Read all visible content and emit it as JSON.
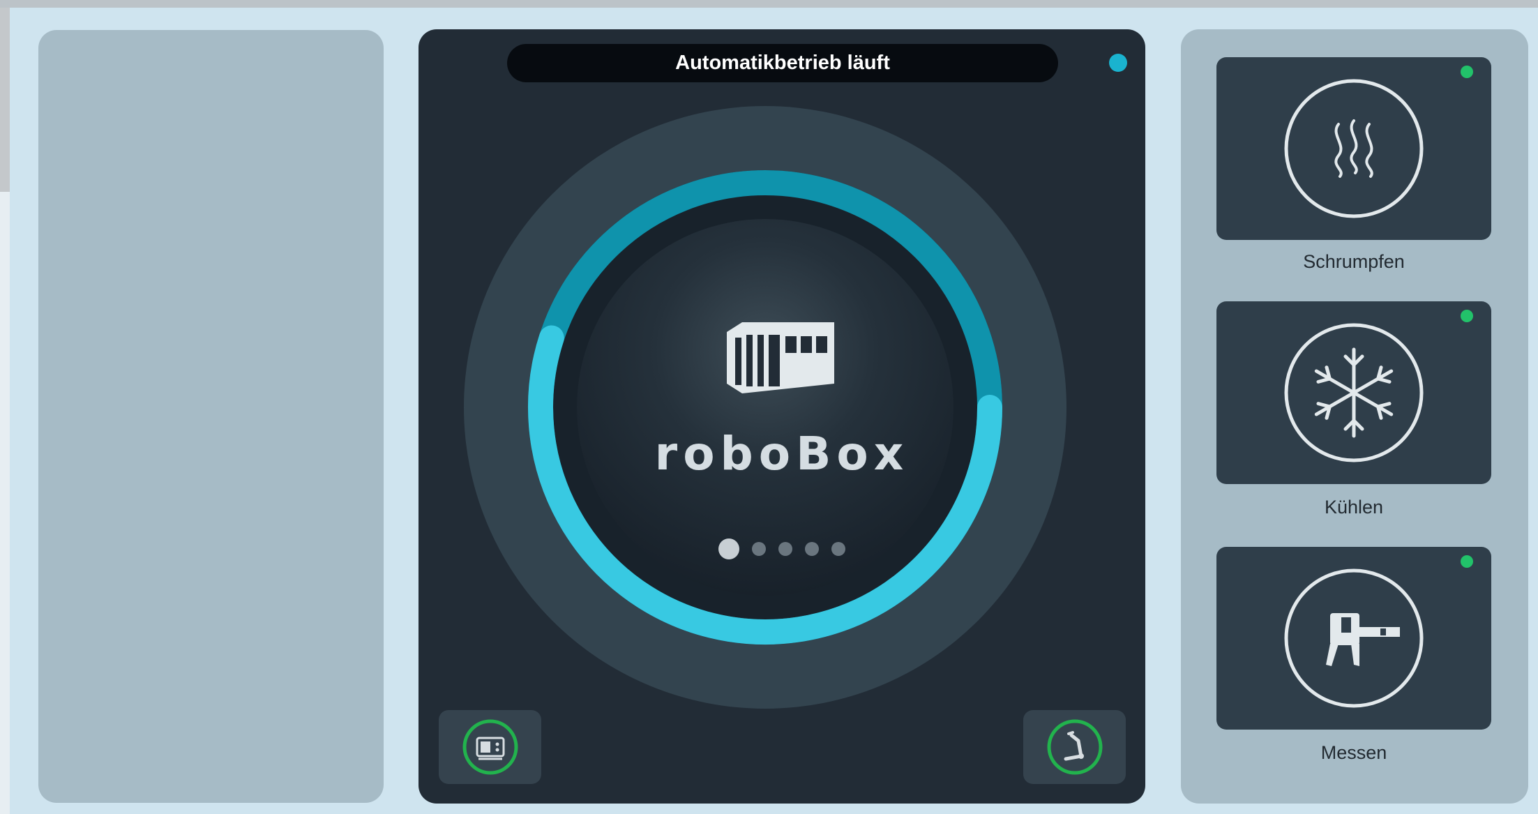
{
  "status": {
    "text": "Automatikbetrieb läuft",
    "led_color": "#1ab3cf"
  },
  "center": {
    "brand": "roboBox",
    "icon": "container-icon",
    "progress": 0.55,
    "page_indicator": {
      "total": 5,
      "active": 1
    },
    "buttons": [
      {
        "icon": "cabinet-icon",
        "ring_color": "#22b34d"
      },
      {
        "icon": "robot-arm-icon",
        "ring_color": "#22b34d"
      }
    ]
  },
  "stations": [
    {
      "label": "Schrumpfen",
      "icon": "heat-waves-icon",
      "status_color": "#22c26a"
    },
    {
      "label": "Kühlen",
      "icon": "snowflake-icon",
      "status_color": "#22c26a"
    },
    {
      "label": "Messen",
      "icon": "caliper-icon",
      "status_color": "#22c26a"
    }
  ],
  "colors": {
    "accent": "#1ab3cf",
    "background": "#cfe4ef",
    "panel": "#222c36"
  }
}
